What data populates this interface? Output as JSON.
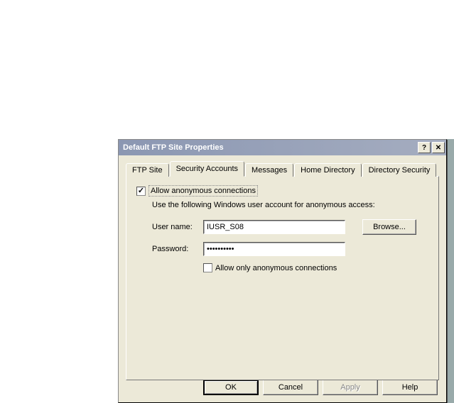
{
  "titlebar": {
    "title": "Default FTP Site Properties",
    "help_glyph": "?",
    "close_glyph": "✕"
  },
  "tabs": {
    "ftp_site": "FTP Site",
    "security_accounts": "Security Accounts",
    "messages": "Messages",
    "home_directory": "Home Directory",
    "directory_security": "Directory Security"
  },
  "panel": {
    "allow_anonymous_label": "Allow anonymous connections",
    "allow_anonymous_checked": true,
    "description": "Use the following Windows user account for anonymous access:",
    "username_label": "User name:",
    "username_value": "IUSR_S08",
    "password_label": "Password:",
    "password_value": "••••••••••",
    "browse_label": "Browse...",
    "allow_only_anon_label": "Allow only anonymous connections",
    "allow_only_anon_checked": false
  },
  "buttons": {
    "ok": "OK",
    "cancel": "Cancel",
    "apply": "Apply",
    "help": "Help"
  }
}
